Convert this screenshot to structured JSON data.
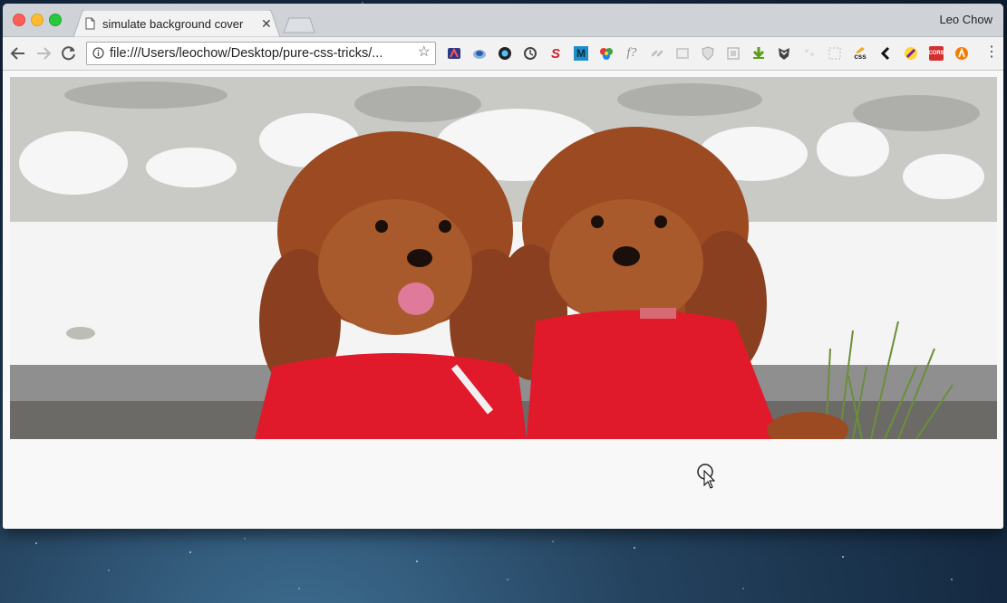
{
  "window": {
    "tab_title": "simulate background cover",
    "profile_name": "Leo Chow"
  },
  "toolbar": {
    "url": "file:///Users/leochow/Desktop/pure-css-tricks/...",
    "extensions": [
      "ext-1",
      "ext-2",
      "ext-3",
      "ext-4",
      "ext-s",
      "ext-m",
      "ext-7",
      "ext-f",
      "ext-9",
      "ext-10",
      "ext-11",
      "ext-12",
      "ext-13",
      "ext-14",
      "ext-15",
      "ext-16",
      "ext-css",
      "ext-back",
      "ext-19",
      "ext-cors",
      "ext-21"
    ],
    "ext_text": {
      "s": "S",
      "m": "M",
      "f": "f?",
      "css": "css",
      "cors": "CORS"
    }
  },
  "content": {
    "image_description_label": "two-poodles-image"
  },
  "colors": {
    "tabstrip": "#cfd3d8",
    "toolbar": "#f2f2f2",
    "page_bg": "#f8f8f8",
    "poodle_fur": "#9b4a22",
    "sweater": "#e0192b"
  }
}
